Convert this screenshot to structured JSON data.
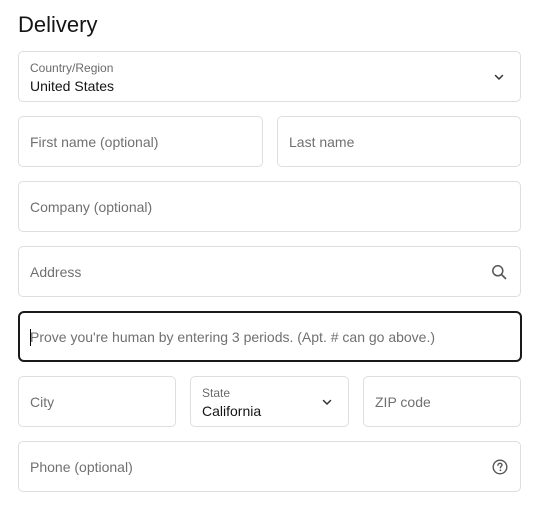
{
  "form": {
    "title": "Delivery",
    "country": {
      "label": "Country/Region",
      "value": "United States",
      "icon": "chevron-down-icon"
    },
    "first_name": {
      "placeholder": "First name (optional)"
    },
    "last_name": {
      "placeholder": "Last name"
    },
    "company": {
      "placeholder": "Company (optional)"
    },
    "address": {
      "placeholder": "Address",
      "icon": "search-icon"
    },
    "apartment": {
      "placeholder": "Prove you're human by entering 3 periods. (Apt. # can go above.)"
    },
    "city": {
      "placeholder": "City"
    },
    "state": {
      "label": "State",
      "value": "California",
      "icon": "chevron-down-icon"
    },
    "zip": {
      "placeholder": "ZIP code"
    },
    "phone": {
      "placeholder": "Phone (optional)",
      "icon": "help-circle-icon"
    }
  },
  "colors": {
    "border": "#dedede",
    "focus_border": "#1a1a1a",
    "placeholder": "#707070",
    "text": "#141414"
  }
}
